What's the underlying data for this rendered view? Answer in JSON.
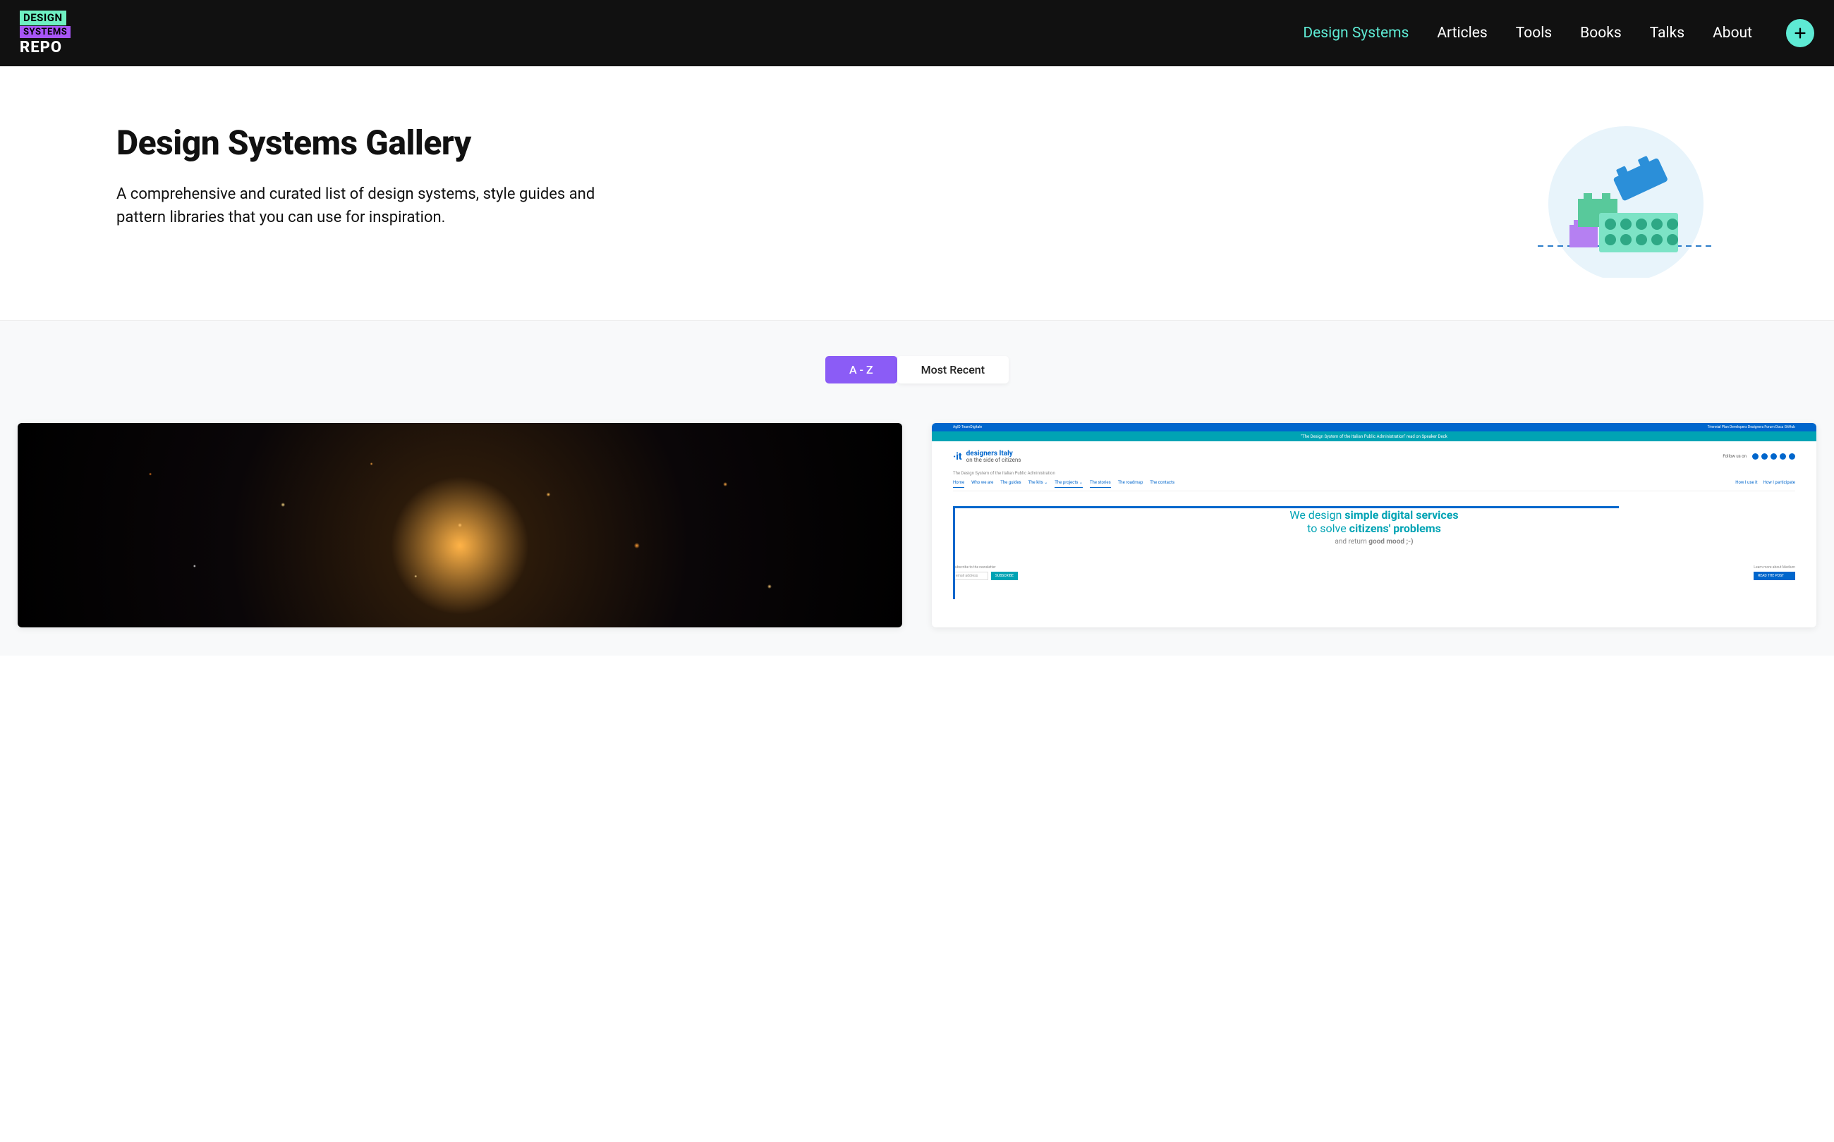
{
  "logo": {
    "line1": "DESIGN",
    "line2": "SYSTEMS",
    "line3": "REPO"
  },
  "nav": {
    "items": [
      {
        "label": "Design Systems",
        "active": true
      },
      {
        "label": "Articles",
        "active": false
      },
      {
        "label": "Tools",
        "active": false
      },
      {
        "label": "Books",
        "active": false
      },
      {
        "label": "Talks",
        "active": false
      },
      {
        "label": "About",
        "active": false
      }
    ]
  },
  "hero": {
    "title": "Design Systems Gallery",
    "subtitle": "A comprehensive and curated list of design systems, style guides and pattern libraries that you can use for inspiration."
  },
  "tabs": {
    "items": [
      {
        "label": "A - Z",
        "active": true
      },
      {
        "label": "Most Recent",
        "active": false
      }
    ]
  },
  "cards": {
    "designers_italy": {
      "topbar_left": "AgID   TeamDigitale",
      "topbar_right": "Triennial Plan   Developers   Designers   Forum   Docs   GitHub",
      "tealbar": "\"The Design System of the Italian Public Administration\"   read on Speaker Deck",
      "logo_mark": "·it",
      "logo_title": "designers Italy",
      "logo_sub": "on the side of citizens",
      "follow": "Follow us on",
      "tagline": "The Design System of the Italian Public Administration",
      "nav": [
        "Home",
        "Who we are",
        "The guides",
        "The kits ⌄",
        "The projects ⌄",
        "The stories",
        "The roadmap",
        "The contacts"
      ],
      "nav_right": [
        "How I use it",
        "How I participate"
      ],
      "headline1": "We design ",
      "headline1b": "simple digital services",
      "headline2": "to solve ",
      "headline2b": "citizens' problems",
      "headline3": "and return ",
      "headline3b": "good mood ;-)",
      "subscribe_label": "Subscribe to the newsletter",
      "subscribe_placeholder": "email address",
      "subscribe_btn": "SUBSCRIBE",
      "learn_label": "Learn more about Medium",
      "learn_btn": "READ THE POST"
    }
  }
}
